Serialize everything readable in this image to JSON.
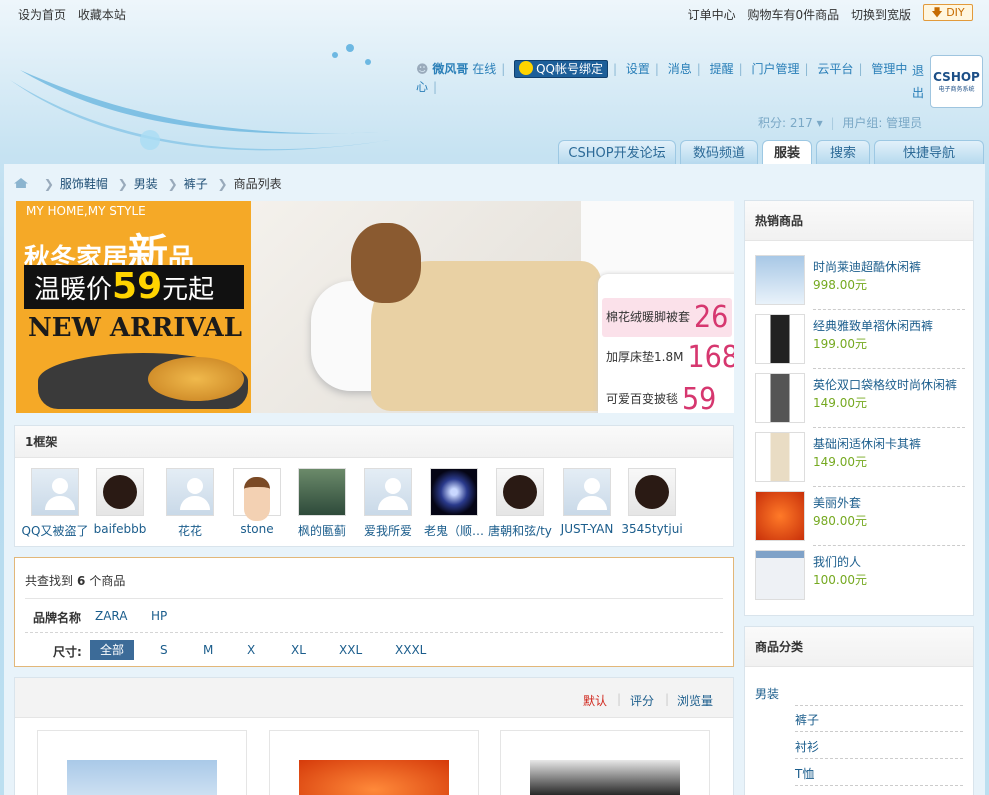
{
  "topbar": {
    "set_home": "设为首页",
    "bookmark": "收藏本站",
    "orders": "订单中心",
    "cart": "购物车有0件商品",
    "widescreen": "切换到宽版",
    "diy": "DIY"
  },
  "user": {
    "name": "微风哥",
    "status": "在线",
    "qq_bind": "QQ帐号绑定",
    "links": [
      "设置",
      "消息",
      "提醒",
      "门户管理",
      "云平台",
      "管理中心"
    ],
    "logout": "退出",
    "points": "积分: 217",
    "group": "用户组: 管理员"
  },
  "logo": {
    "title": "CSHOP",
    "subtitle": "电子商务系统"
  },
  "nav_tabs": [
    {
      "label": "CSHOP开发论坛",
      "active": false
    },
    {
      "label": "数码频道",
      "active": false
    },
    {
      "label": "服装",
      "active": true
    },
    {
      "label": "搜索",
      "active": false
    },
    {
      "label": "快捷导航",
      "active": false
    }
  ],
  "breadcrumb": [
    "服饰鞋帽",
    "男装",
    "裤子",
    "商品列表"
  ],
  "banner": {
    "tagline": "MY HOME,MY STYLE",
    "title_a": "秋冬家居",
    "title_b": "新",
    "title_c": "品",
    "price_label": "温暖价",
    "price": "59",
    "price_suffix": "元起",
    "arrival": "NEW ARRIVAL",
    "items": [
      {
        "name": "棉花绒暖脚被套",
        "price": "26"
      },
      {
        "name": "加厚床垫1.8M",
        "price": "168"
      },
      {
        "name": "可爱百变披毯",
        "price": "59"
      }
    ]
  },
  "friends_panel": {
    "title": "1框架",
    "friends": [
      {
        "name": "QQ又被盗了",
        "avatar": "placeholder"
      },
      {
        "name": "baifebbb",
        "avatar": "girl"
      },
      {
        "name": "花花",
        "avatar": "placeholder"
      },
      {
        "name": "stone",
        "avatar": "boy"
      },
      {
        "name": "枫的匭蓟",
        "avatar": "photo1"
      },
      {
        "name": "爱我所爱",
        "avatar": "placeholder"
      },
      {
        "name": "老鬼（顺…",
        "avatar": "photo2"
      },
      {
        "name": "唐朝和弦/ty",
        "avatar": "girl"
      },
      {
        "name": "JUST-YAN",
        "avatar": "placeholder"
      },
      {
        "name": "3545tytjui",
        "avatar": "girl"
      }
    ]
  },
  "filter": {
    "found_prefix": "共查找到",
    "found_count": "6",
    "found_suffix": "个商品",
    "brand_label": "品牌名称",
    "brands": [
      "ZARA",
      "HP"
    ],
    "size_label": "尺寸:",
    "sizes": [
      "全部",
      "S",
      "M",
      "X",
      "XL",
      "XXL",
      "XXXL"
    ]
  },
  "sort": {
    "default": "默认",
    "rating": "评分",
    "views": "浏览量"
  },
  "hot_products": {
    "title": "热销商品",
    "items": [
      {
        "name": "时尚莱迪超酷休闲裤",
        "price": "998.00元"
      },
      {
        "name": "经典雅致单褶休闲西裤",
        "price": "199.00元"
      },
      {
        "name": "英伦双口袋格纹时尚休闲裤",
        "price": "149.00元"
      },
      {
        "name": "基础闲适休闲卡其裤",
        "price": "149.00元"
      },
      {
        "name": "美丽外套",
        "price": "980.00元"
      },
      {
        "name": "我们的人",
        "price": "100.00元"
      }
    ]
  },
  "categories": {
    "title": "商品分类",
    "top": "男装",
    "subs": [
      "裤子",
      "衬衫",
      "T恤"
    ]
  },
  "colors": {
    "accent": "#3c6b98",
    "price": "#75a920",
    "link": "#1b5d8c",
    "active_sort": "#d0261c"
  }
}
